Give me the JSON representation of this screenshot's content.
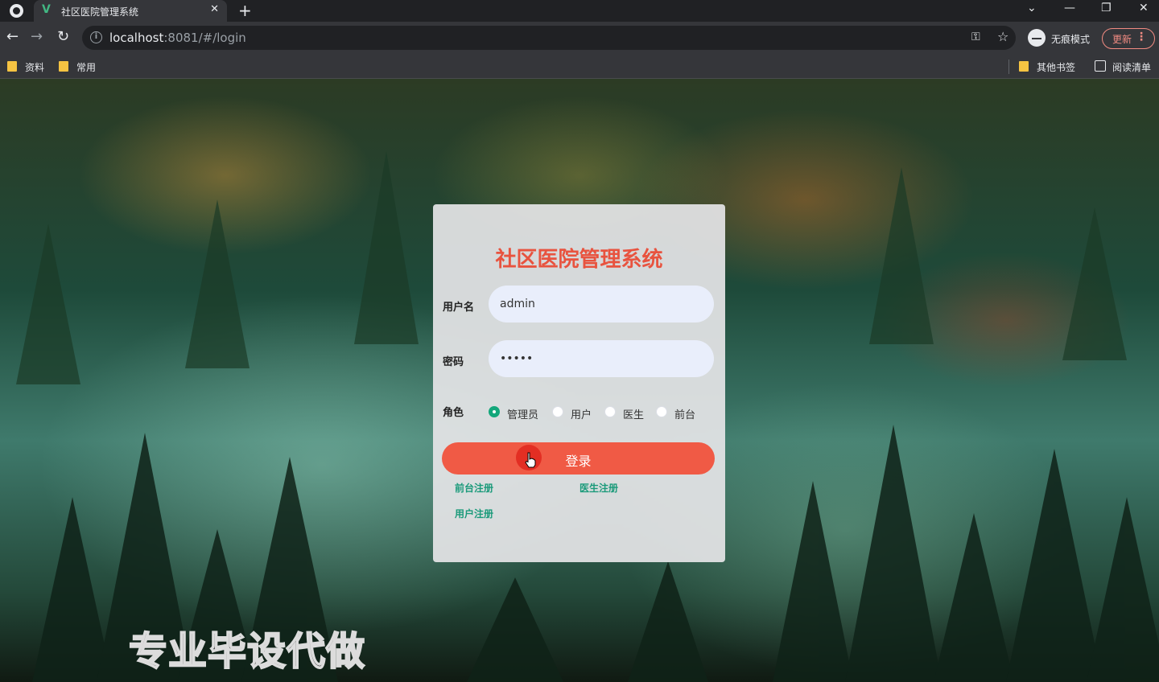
{
  "browser": {
    "tab_title": "社区医院管理系统",
    "tab_favicon": "V",
    "close_glyph": "✕",
    "new_tab_glyph": "+",
    "url_host": "localhost",
    "url_rest": ":8081/#/login",
    "incognito_label": "无痕模式",
    "update_label": "更新",
    "bookmarks": [
      "资料",
      "常用"
    ],
    "other_bookmarks": "其他书签",
    "reading_list": "阅读清单"
  },
  "login": {
    "title": "社区医院管理系统",
    "username_label": "用户名",
    "username_value": "admin",
    "password_label": "密码",
    "password_value": "admin",
    "role_label": "角色",
    "roles": [
      "管理员",
      "用户",
      "医生",
      "前台"
    ],
    "selected_role": "管理员",
    "login_button": "登录",
    "links": {
      "front_register": "前台注册",
      "doctor_register": "医生注册",
      "user_register": "用户注册"
    }
  },
  "watermark": "专业毕设代做",
  "colors": {
    "title": "#e8533f",
    "button": "#f05a45",
    "radio_checked": "#13a77b",
    "link": "#1a9a7a",
    "input_bg": "#e9eefb"
  }
}
